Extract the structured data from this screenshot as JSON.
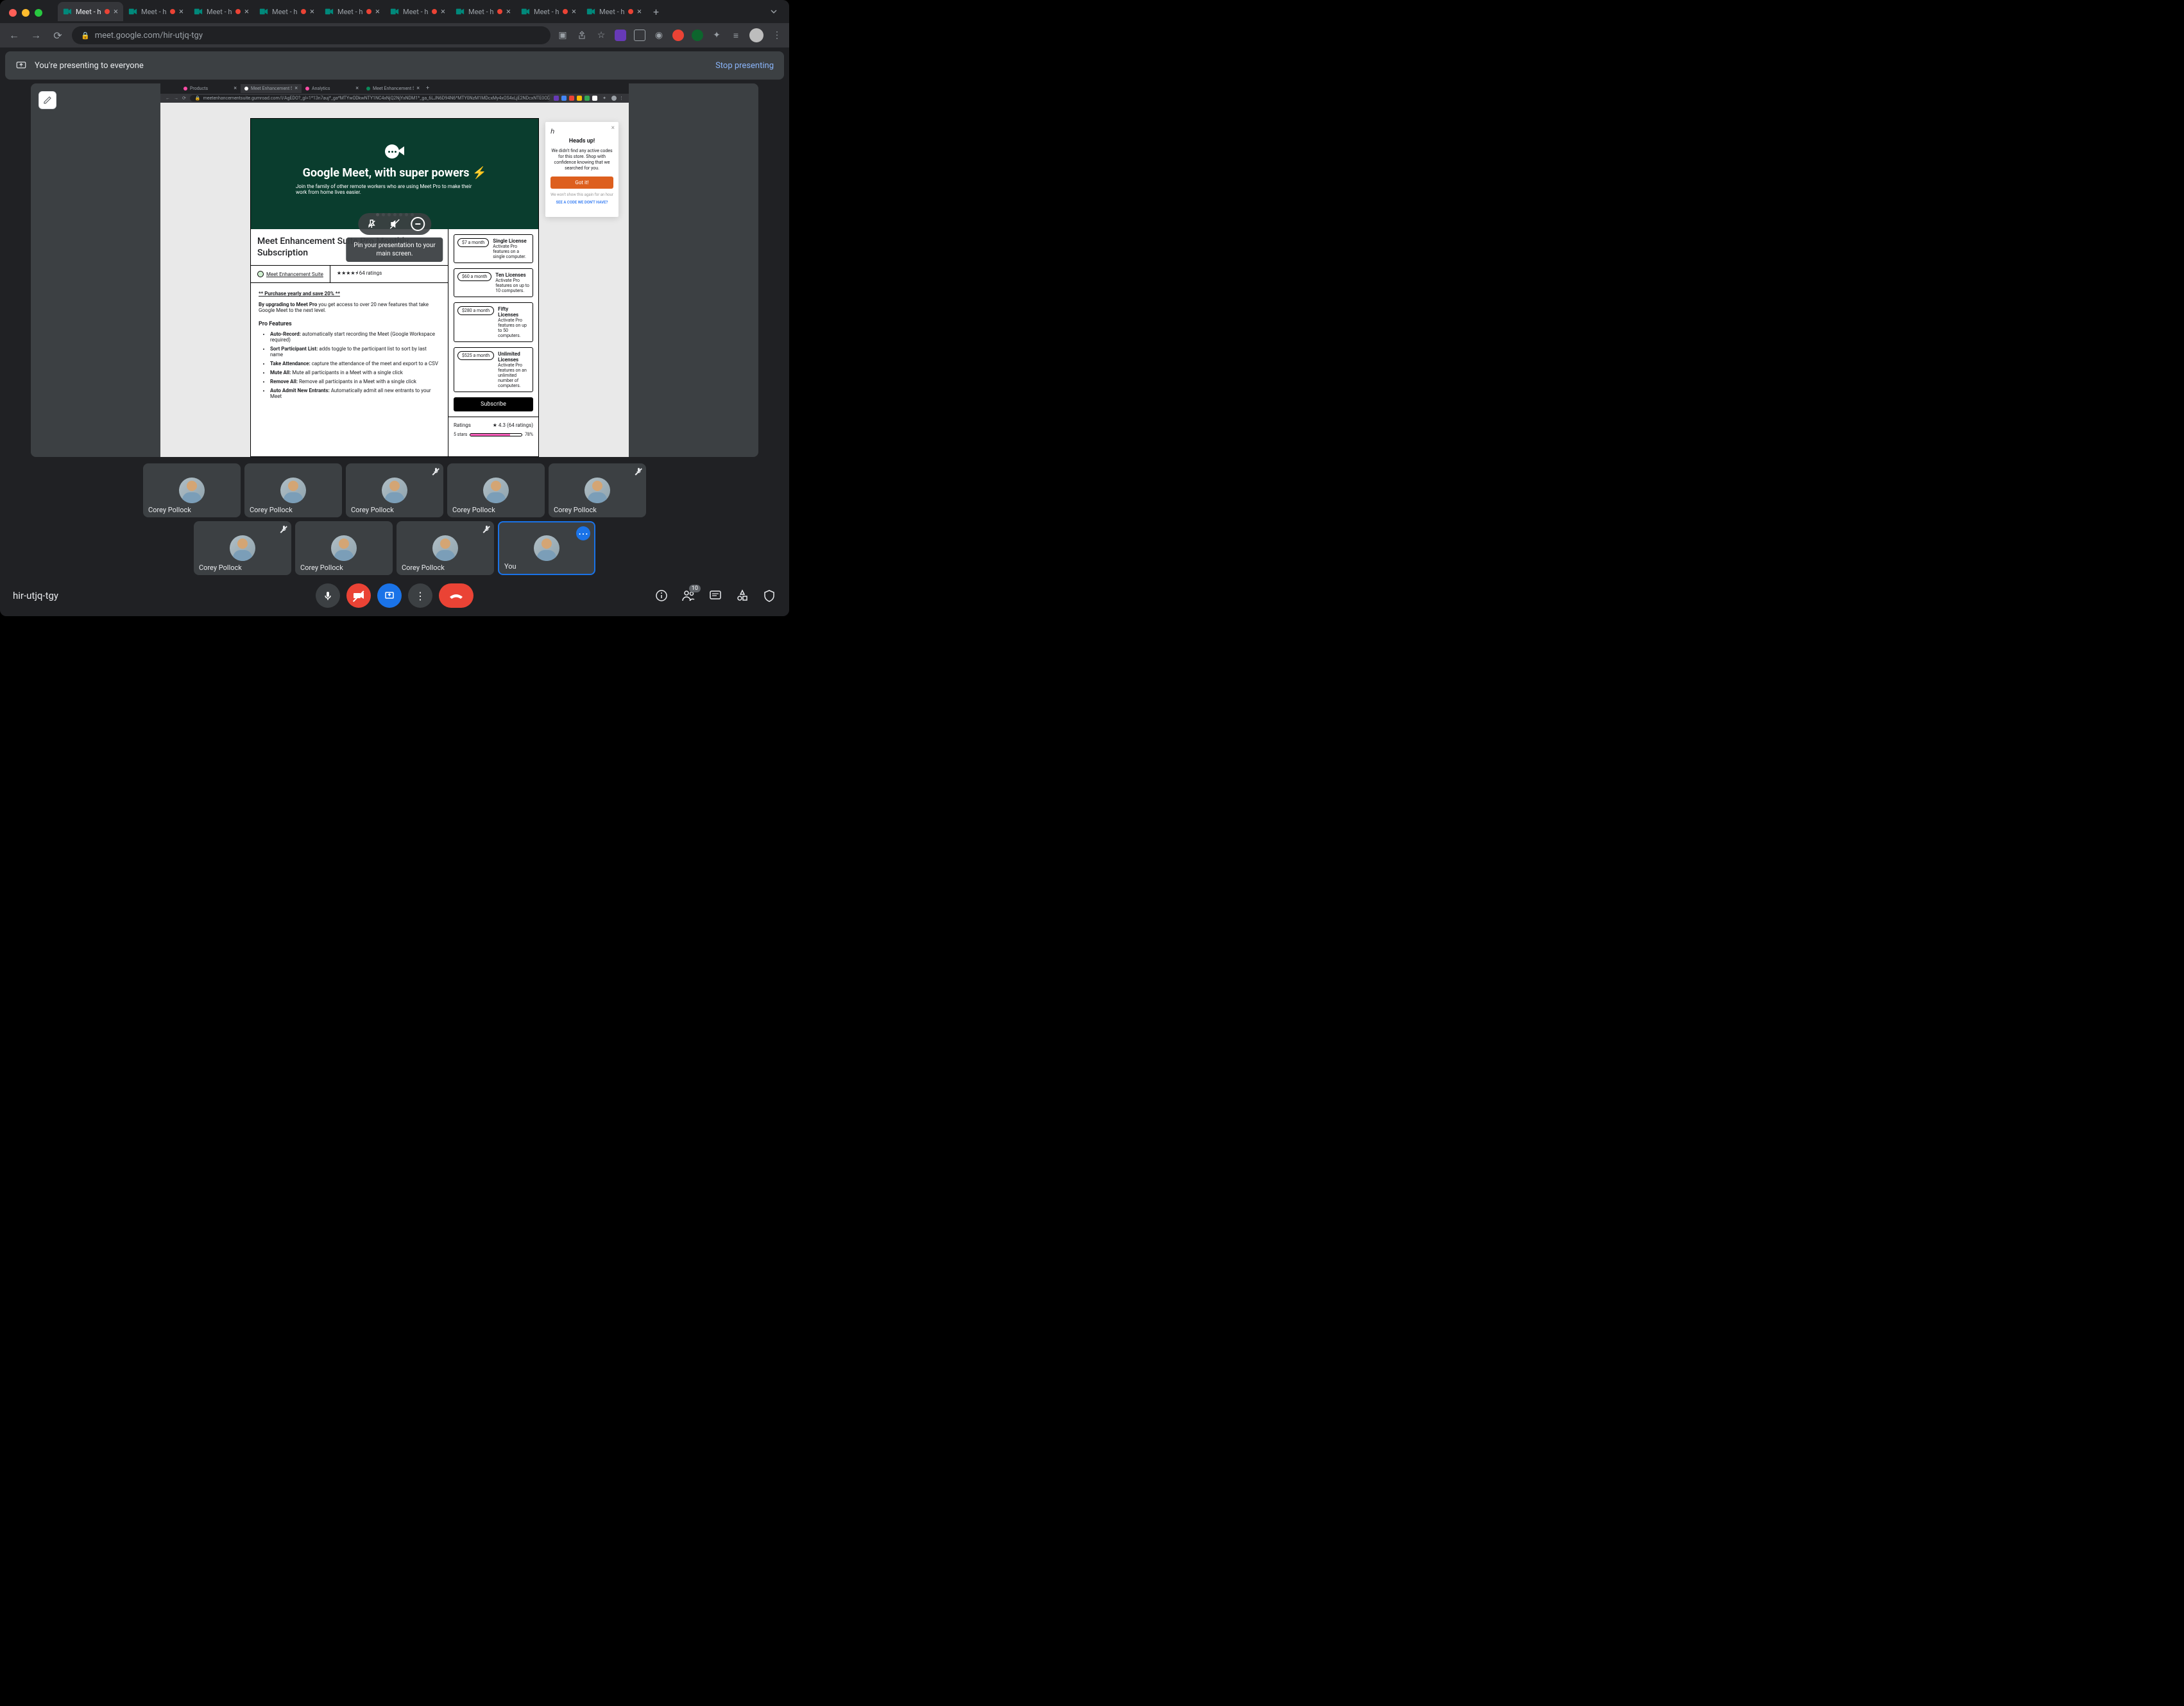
{
  "browser": {
    "url": "meet.google.com/hir-utjq-tgy",
    "tabs": [
      {
        "title": "Meet - hir-u",
        "active": true
      },
      {
        "title": "Meet - hir-u",
        "active": false
      },
      {
        "title": "Meet - hir-u",
        "active": false
      },
      {
        "title": "Meet - hir-u",
        "active": false
      },
      {
        "title": "Meet - hir-u",
        "active": false
      },
      {
        "title": "Meet - hir-u",
        "active": false
      },
      {
        "title": "Meet - hir-u",
        "active": false
      },
      {
        "title": "Meet - hir-u",
        "active": false
      },
      {
        "title": "Meet - hir-u",
        "active": false
      }
    ]
  },
  "presenting": {
    "text": "You're presenting to everyone",
    "stop": "Stop presenting"
  },
  "tooltip": "Pin your presentation to your\nmain screen.",
  "shared_screen": {
    "tabs": [
      {
        "title": "Products",
        "active": false,
        "color": "#ff4da6"
      },
      {
        "title": "Meet Enhancement Suite Pro",
        "active": true,
        "color": "#fff"
      },
      {
        "title": "Analytics",
        "active": false,
        "color": "#ff4da6"
      },
      {
        "title": "Meet Enhancement Suite - Mo",
        "active": false,
        "color": "#0a8a5a"
      }
    ],
    "url": "meetenhancementsuite.gumroad.com/l/AgEDO?_gl=1*13n7auj*_ga*MTYwODkwNTY1NC4xNjQ2NjYxNDM1*_ga_6LJN6D94N6*MTY0NzM1MDcxMy4xOS4xLjE2NDcxNTE0ODAuMA..",
    "hero": {
      "title": "Google Meet, with super powers ⚡️",
      "subtitle": "Join the family of other remote workers who are using Meet Pro to make their work from home lives easier."
    },
    "product": {
      "title": "Meet Enhancement Suite Pro Monthly Subscription",
      "author": "Meet Enhancement Suite",
      "rating_text": "★★★★⯨ 64 ratings",
      "promo": "** Purchase yearly and save 20% **",
      "description_lead": "By upgrading to Meet Pro",
      "description": " you get access to over 20 new features that take Google Meet to the next level.",
      "features_title": "Pro Features",
      "features": [
        {
          "bold": "Auto-Record:",
          "text": " automatically start recording the Meet (Google Workspace required)"
        },
        {
          "bold": "Sort Participant List:",
          "text": " adds toggle to the participant list to sort by last name"
        },
        {
          "bold": "Take Attendance:",
          "text": " capture the attendance of the meet and export to a CSV"
        },
        {
          "bold": "Mute All:",
          "text": " Mute all participants in a Meet with a single click"
        },
        {
          "bold": "Remove All:",
          "text": " Remove all participants in a Meet with a single click"
        },
        {
          "bold": "Auto Admit New Entrants:",
          "text": " Automatically admit all new entrants to your Meet"
        }
      ]
    },
    "pricing": [
      {
        "price": "$7 a month",
        "title": "Single License",
        "sub": "Activate Pro features on a single computer."
      },
      {
        "price": "$60 a month",
        "title": "Ten Licenses",
        "sub": "Activate Pro features on up to 10 computers."
      },
      {
        "price": "$280 a month",
        "title": "Fifty Licenses",
        "sub": "Activate Pro features on up to 50 computers."
      },
      {
        "price": "$525 a month",
        "title": "Unlimited Licenses",
        "sub": "Activate Pro features on an unlimited number of computers."
      }
    ],
    "subscribe": "Subscribe",
    "ratings": {
      "title": "Ratings",
      "score": "★ 4.3 (64 ratings)",
      "bars": [
        {
          "label": "5 stars",
          "pct": 78
        }
      ]
    },
    "headsup": {
      "title": "Heads up!",
      "body": "We didn't find any active codes for this store. Shop with confidence knowing that we searched for you.",
      "cta": "Got it!",
      "dismiss": "We won't show this again for an hour",
      "link": "SEE A CODE WE DON'T HAVE?"
    }
  },
  "participants": {
    "row1": [
      {
        "name": "Corey Pollock",
        "muted": false
      },
      {
        "name": "Corey Pollock",
        "muted": false
      },
      {
        "name": "Corey Pollock",
        "muted": true
      },
      {
        "name": "Corey Pollock",
        "muted": false
      },
      {
        "name": "Corey Pollock",
        "muted": true
      }
    ],
    "row2": [
      {
        "name": "Corey Pollock",
        "muted": true
      },
      {
        "name": "Corey Pollock",
        "muted": false
      },
      {
        "name": "Corey Pollock",
        "muted": true
      },
      {
        "name": "You",
        "you": true
      }
    ]
  },
  "bottom": {
    "code": "hir-utjq-tgy",
    "count": "10"
  }
}
